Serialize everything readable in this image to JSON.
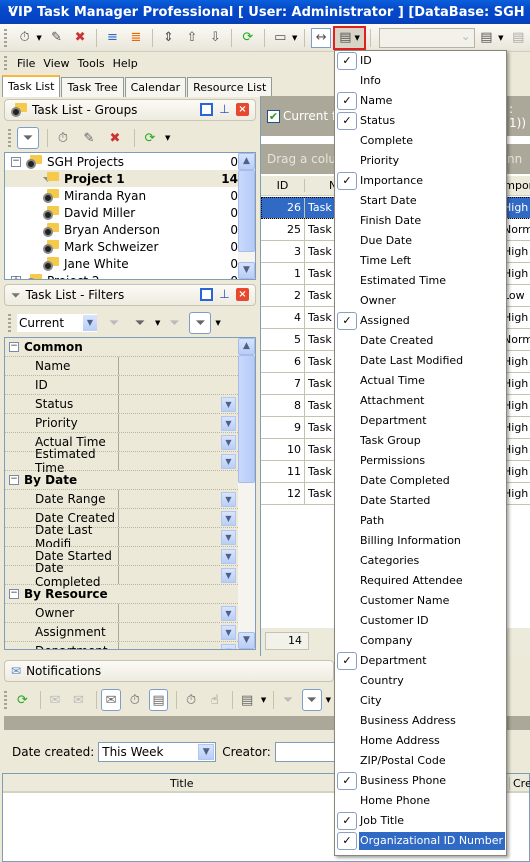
{
  "window": {
    "title": "VIP Task Manager Professional [ User: Administrator ] [DataBase: SGH Projects]"
  },
  "toolbar": {
    "icons": [
      "new-task-icon",
      "edit-task-icon",
      "delete-task-icon",
      "indent-icon",
      "outdent-icon",
      "move-updown-icon",
      "move-up-icon",
      "move-down-icon",
      "refresh-icon",
      "task-view-icon",
      "best-fit-icon",
      "column-chooser-icon",
      "view-icon",
      "save-view-icon",
      "delete-view-icon"
    ],
    "view_combo_value": ""
  },
  "menubar": {
    "items": [
      "File",
      "View",
      "Tools",
      "Help"
    ]
  },
  "tabs": [
    {
      "label": "Task List",
      "active": true
    },
    {
      "label": "Task Tree",
      "active": false
    },
    {
      "label": "Calendar",
      "active": false
    },
    {
      "label": "Resource List",
      "active": false
    }
  ],
  "groups_panel": {
    "title": "Task List - Groups",
    "tree": [
      {
        "label": "SGH Projects",
        "count": "0",
        "level": 0,
        "expanded": true,
        "icon": "project-folder-icon"
      },
      {
        "label": "Project 1",
        "count": "14",
        "level": 1,
        "selected": true,
        "icon": "filter-folder-icon"
      },
      {
        "label": "Miranda Ryan",
        "count": "0",
        "level": 1,
        "icon": "clock-folder-icon"
      },
      {
        "label": "David Miller",
        "count": "0",
        "level": 1,
        "icon": "clock-folder-icon"
      },
      {
        "label": "Bryan Anderson",
        "count": "0",
        "level": 1,
        "icon": "clock-folder-icon"
      },
      {
        "label": "Mark Schweizer",
        "count": "0",
        "level": 1,
        "icon": "clock-folder-icon"
      },
      {
        "label": "Jane White",
        "count": "0",
        "level": 1,
        "icon": "clock-folder-icon"
      },
      {
        "label": "Project 2",
        "count": "0",
        "level": 0,
        "expanded": false,
        "icon": "project-folder-icon"
      }
    ]
  },
  "filters_panel": {
    "title": "Task List - Filters",
    "current_filter": "Current",
    "categories": [
      {
        "name": "Common",
        "fields": [
          {
            "label": "Name",
            "dropdown": false
          },
          {
            "label": "ID",
            "dropdown": false
          },
          {
            "label": "Status",
            "dropdown": true
          },
          {
            "label": "Priority",
            "dropdown": true
          },
          {
            "label": "Actual Time",
            "dropdown": true
          },
          {
            "label": "Estimated Time",
            "dropdown": true
          }
        ]
      },
      {
        "name": "By Date",
        "fields": [
          {
            "label": "Date Range",
            "dropdown": true
          },
          {
            "label": "Date Created",
            "dropdown": true
          },
          {
            "label": "Date Last Modifi",
            "dropdown": true
          },
          {
            "label": "Date Started",
            "dropdown": true
          },
          {
            "label": "Date Completed",
            "dropdown": true
          }
        ]
      },
      {
        "name": "By Resource",
        "fields": [
          {
            "label": "Owner",
            "dropdown": true
          },
          {
            "label": "Assignment",
            "dropdown": true
          },
          {
            "label": "Department",
            "dropdown": true
          }
        ]
      }
    ]
  },
  "task_grid": {
    "filter_label": "Current filt",
    "filter_suffix": ": 1))",
    "group_hint": "Drag a column",
    "group_hint_suffix": "nn",
    "columns": [
      "ID",
      "N",
      "Import"
    ],
    "rows": [
      {
        "id": "26",
        "name": "Task",
        "importance": "High",
        "selected": true
      },
      {
        "id": "25",
        "name": "Task",
        "importance": "Normal"
      },
      {
        "id": "3",
        "name": "Task",
        "importance": "High"
      },
      {
        "id": "1",
        "name": "Task",
        "importance": "High"
      },
      {
        "id": "2",
        "name": "Task",
        "importance": "Low"
      },
      {
        "id": "4",
        "name": "Task",
        "importance": "High"
      },
      {
        "id": "5",
        "name": "Task",
        "importance": "Normal"
      },
      {
        "id": "6",
        "name": "Task",
        "importance": "High"
      },
      {
        "id": "7",
        "name": "Task",
        "importance": "High"
      },
      {
        "id": "8",
        "name": "Task",
        "importance": "High"
      },
      {
        "id": "9",
        "name": "Task",
        "importance": "High"
      },
      {
        "id": "10",
        "name": "Task",
        "importance": "High"
      },
      {
        "id": "11",
        "name": "Task",
        "importance": "High"
      },
      {
        "id": "12",
        "name": "Task",
        "importance": "High"
      }
    ],
    "footer_count": "14"
  },
  "column_menu": {
    "items": [
      {
        "label": "ID",
        "checked": true
      },
      {
        "label": "Info",
        "checked": false
      },
      {
        "label": "Name",
        "checked": true
      },
      {
        "label": "Status",
        "checked": true
      },
      {
        "label": "Complete",
        "checked": false
      },
      {
        "label": "Priority",
        "checked": false
      },
      {
        "label": "Importance",
        "checked": true
      },
      {
        "label": "Start Date",
        "checked": false
      },
      {
        "label": "Finish Date",
        "checked": false
      },
      {
        "label": "Due Date",
        "checked": false
      },
      {
        "label": "Time Left",
        "checked": false
      },
      {
        "label": "Estimated Time",
        "checked": false
      },
      {
        "label": "Owner",
        "checked": false
      },
      {
        "label": "Assigned",
        "checked": true
      },
      {
        "label": "Date Created",
        "checked": false
      },
      {
        "label": "Date Last Modified",
        "checked": false
      },
      {
        "label": "Actual Time",
        "checked": false
      },
      {
        "label": "Attachment",
        "checked": false
      },
      {
        "label": "Department",
        "checked": false
      },
      {
        "label": "Task Group",
        "checked": false
      },
      {
        "label": "Permissions",
        "checked": false
      },
      {
        "label": "Date Completed",
        "checked": false
      },
      {
        "label": "Date Started",
        "checked": false
      },
      {
        "label": "Path",
        "checked": false
      },
      {
        "label": "Billing Information",
        "checked": false
      },
      {
        "label": "Categories",
        "checked": false
      },
      {
        "label": "Required Attendee",
        "checked": false
      },
      {
        "label": "Customer Name",
        "checked": false
      },
      {
        "label": "Customer ID",
        "checked": false
      },
      {
        "label": "Company",
        "checked": false
      },
      {
        "label": "Department",
        "checked": true
      },
      {
        "label": "Country",
        "checked": false
      },
      {
        "label": "City",
        "checked": false
      },
      {
        "label": "Business Address",
        "checked": false
      },
      {
        "label": "Home Address",
        "checked": false
      },
      {
        "label": "ZIP/Postal Code",
        "checked": false
      },
      {
        "label": "Business Phone",
        "checked": true
      },
      {
        "label": "Home Phone",
        "checked": false
      },
      {
        "label": "Job Title",
        "checked": true
      },
      {
        "label": "Organizational ID Number",
        "checked": true,
        "highlighted": true
      }
    ]
  },
  "notifications": {
    "title": "Notifications",
    "date_created_label": "Date created:",
    "date_created_value": "This Week",
    "creator_label": "Creator:",
    "creator_value": "",
    "columns": [
      "Title",
      "Crea"
    ]
  },
  "colors": {
    "selection": "#316ac5",
    "titlebar": "#0548c8",
    "accent_tab": "#f8b93a",
    "highlight_box": "#e02020"
  }
}
